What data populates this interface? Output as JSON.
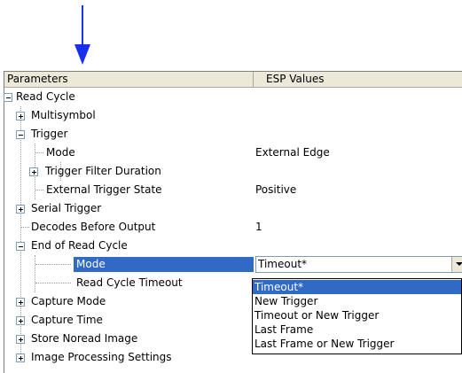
{
  "table": {
    "col_params": "Parameters",
    "col_values": "ESP Values"
  },
  "tree": {
    "read_cycle": "Read Cycle",
    "multisymbol": "Multisymbol",
    "trigger": "Trigger",
    "trigger_mode": {
      "label": "Mode",
      "value": "External Edge"
    },
    "trigger_filter_duration": "Trigger Filter Duration",
    "external_trigger_state": {
      "label": "External Trigger State",
      "value": "Positive"
    },
    "serial_trigger": "Serial Trigger",
    "decodes_before_output": {
      "label": "Decodes Before Output",
      "value": "1"
    },
    "end_of_read_cycle": "End of Read Cycle",
    "eorc_mode": {
      "label": "Mode",
      "value": "Timeout*"
    },
    "read_cycle_timeout": "Read Cycle Timeout",
    "capture_mode": "Capture Mode",
    "capture_time": "Capture Time",
    "store_noread_image": "Store Noread Image",
    "image_processing_settings": "Image Processing Settings"
  },
  "dropdown": {
    "options": [
      "Timeout*",
      "New Trigger",
      "Timeout or New Trigger",
      "Last Frame",
      "Last Frame or New Trigger"
    ],
    "highlighted": "Timeout*"
  },
  "colors": {
    "arrow": "#1a2ef0",
    "selection": "#316ac5",
    "header_bg": "#ece9d8"
  }
}
